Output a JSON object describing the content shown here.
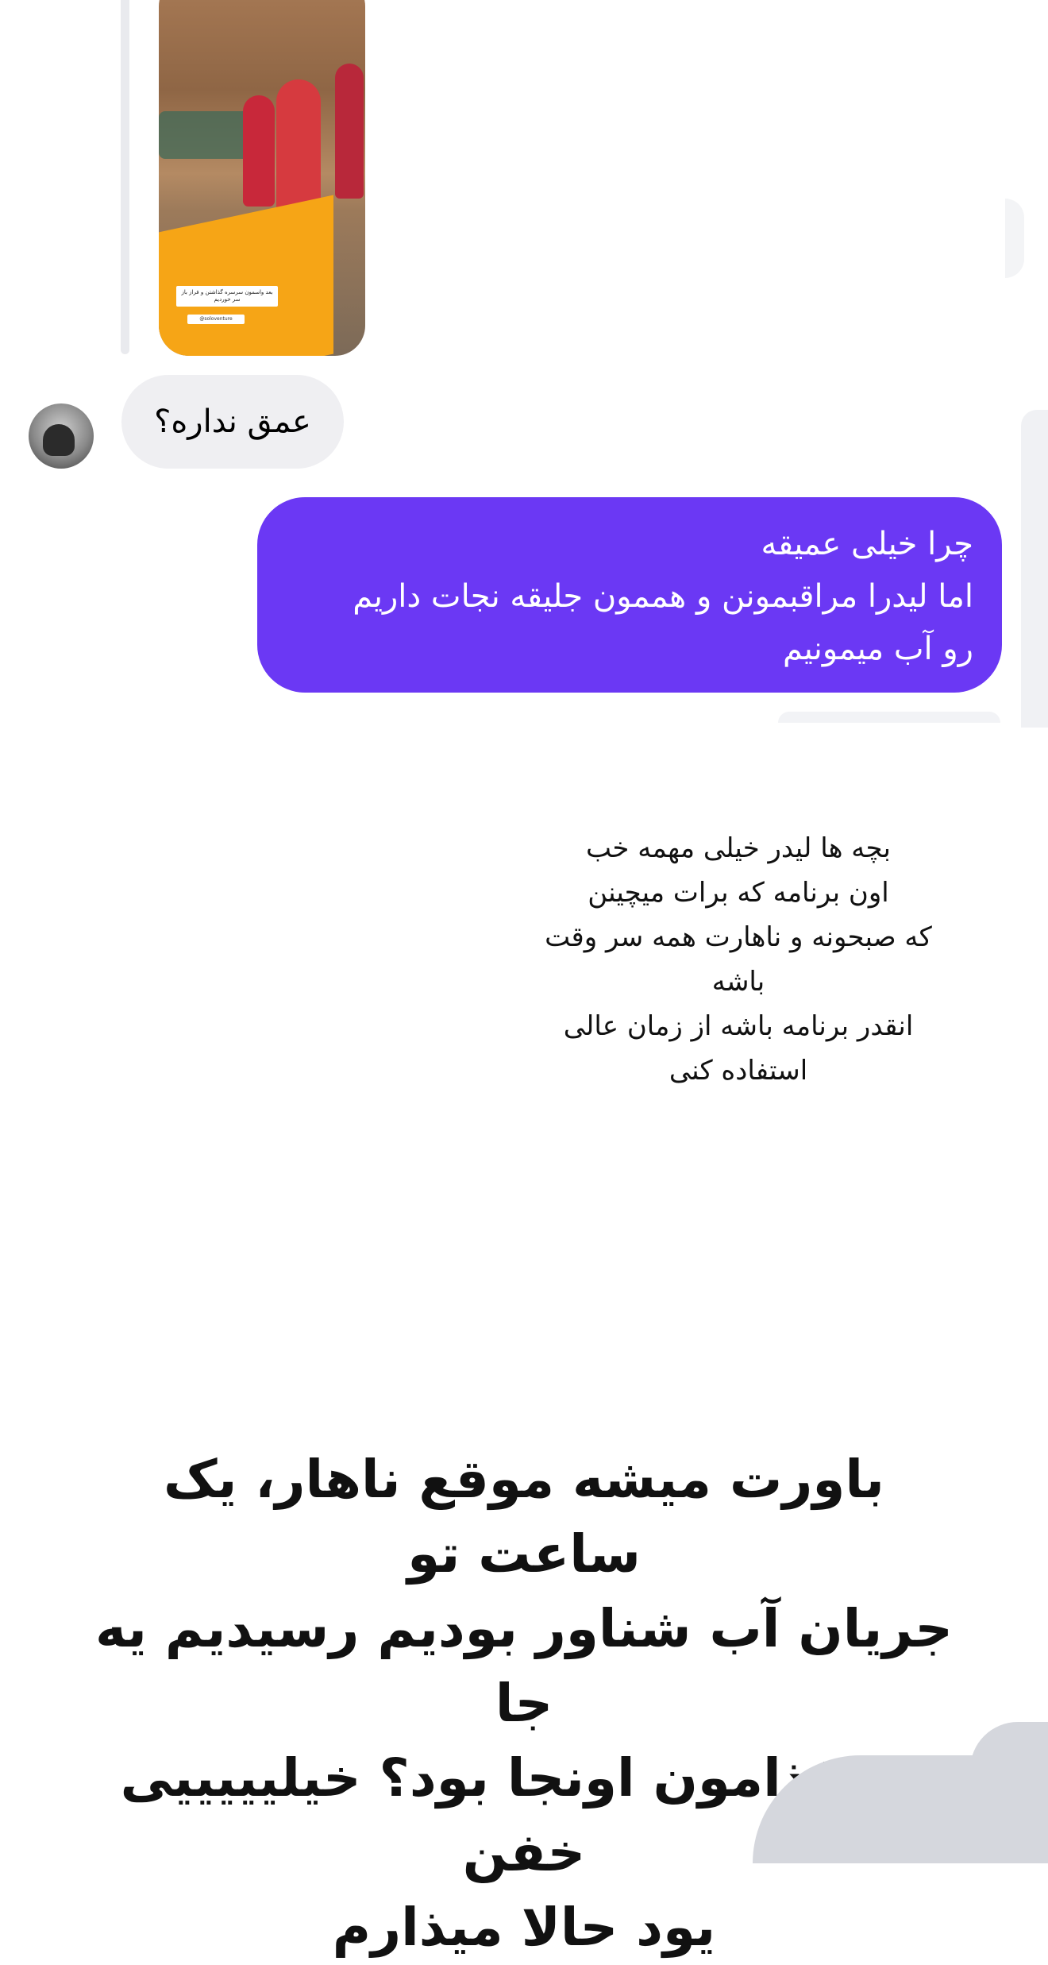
{
  "story_reply": {
    "sticker_text": "بعد واسمون سرسره گذاشتن و فراز باز سر خوردیم",
    "mention": "@soloventure"
  },
  "messages": {
    "incoming": "عمق نداره؟",
    "outgoing_lines": [
      "چرا خیلی عمیقه",
      "اما لیدرا مراقبمونن و هممون جلیقه نجات داریم",
      "رو آب میمونیم"
    ]
  },
  "story_text_lines": [
    "بچه ها لیدر خیلی مهمه خب",
    "اون برنامه که برات میچینن",
    "که صبحونه و ناهارت همه سر وقت",
    "باشه",
    "انقدر برنامه باشه از زمان عالی",
    "استفاده کنی"
  ],
  "story_big_lines": [
    "باورت میشه موقع ناهار، یک ساعت تو",
    "جریان آب شناور بودیم رسیدیم یه جا",
    "که غذامون اونجا بود؟ خیلیییییی خفن",
    "یود حالا میذارم"
  ],
  "colors": {
    "outgoing_bubble": "#6b38f4",
    "incoming_bubble": "#efeff2"
  }
}
